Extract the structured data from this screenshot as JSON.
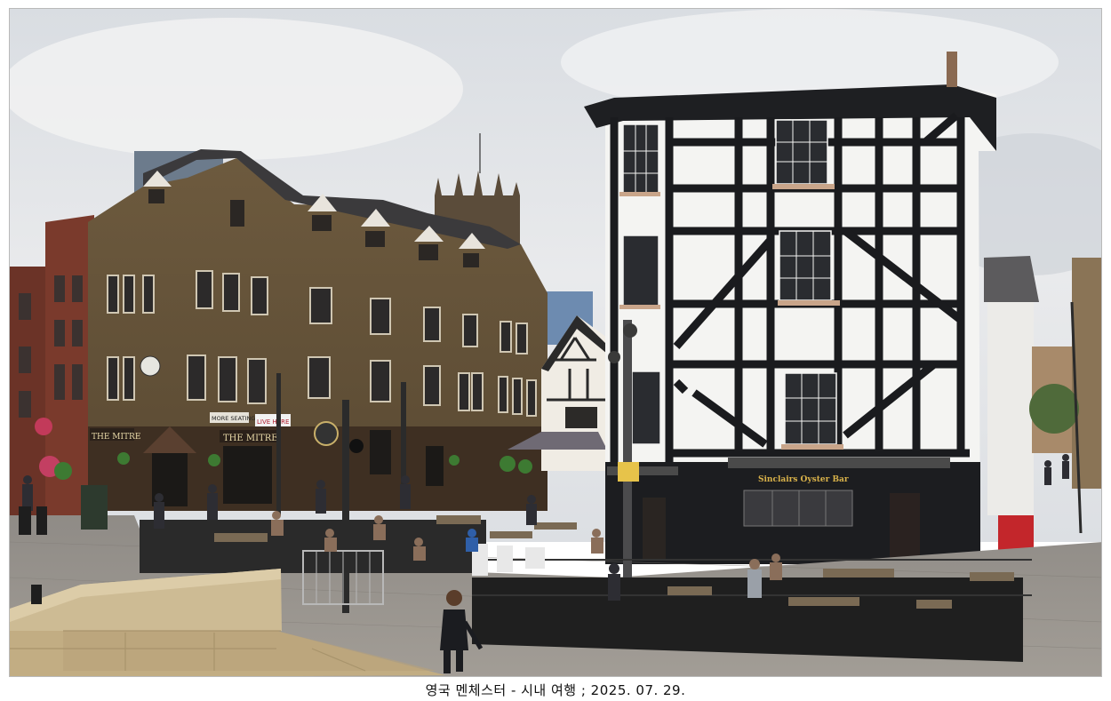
{
  "photo": {
    "signs": {
      "the_mitre": "THE MITRE",
      "the_mitre_left": "THE MITRE",
      "more_seating": "MORE SEATING",
      "live_here": "LIVE HERE",
      "sinclairs": "Sinclairs Oyster Bar"
    }
  },
  "caption": "영국 멘체스터 - 시내 여행 ; 2025. 07. 29."
}
